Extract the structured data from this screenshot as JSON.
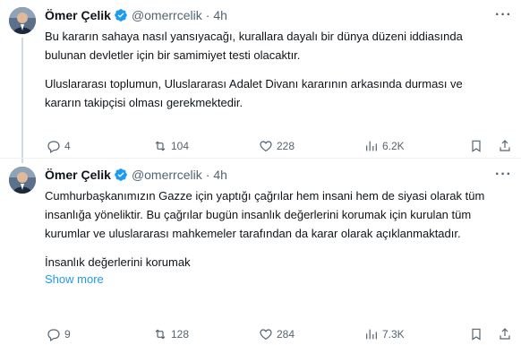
{
  "tweets": [
    {
      "author_name": "Ömer Çelik",
      "handle": "@omerrcelik",
      "dot": "·",
      "time": "4h",
      "paragraphs": [
        "Bu kararın sahaya nasıl yansıyacağı, kurallara dayalı bir dünya düzeni iddiasında bulunan devletler için bir samimiyet testi olacaktır.",
        "Uluslararası toplumun, Uluslararası Adalet Divanı kararının arkasında durması ve kararın takipçisi olması gerekmektedir."
      ],
      "show_more": "",
      "replies": "4",
      "reposts": "104",
      "likes": "228",
      "views": "6.2K"
    },
    {
      "author_name": "Ömer Çelik",
      "handle": "@omerrcelik",
      "dot": "·",
      "time": "4h",
      "paragraphs": [
        "Cumhurbaşkanımızın Gazze için yaptığı çağrılar hem insani hem de siyasi olarak tüm insanlığa yöneliktir. Bu çağrılar bugün insanlık değerlerini korumak için kurulan tüm kurumlar ve uluslararası mahkemeler tarafından da karar olarak açıklanmaktadır.",
        "İnsanlık değerlerini korumak"
      ],
      "show_more": "Show more",
      "replies": "9",
      "reposts": "128",
      "likes": "284",
      "views": "7.3K"
    }
  ],
  "icons": {
    "verified": "verified-badge-icon",
    "more": "more-icon",
    "reply": "reply-icon",
    "repost": "repost-icon",
    "like": "like-icon",
    "views": "views-icon",
    "bookmark": "bookmark-icon",
    "share": "share-icon"
  },
  "colors": {
    "accent": "#1d9bf0",
    "secondary_text": "#536471",
    "text": "#0f1419"
  }
}
